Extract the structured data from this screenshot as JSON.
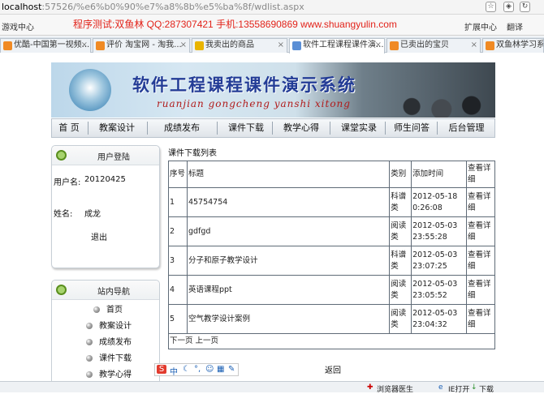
{
  "browser": {
    "url_host": "localhost",
    "url_path": ":57526/%e6%b0%90%e7%a8%8b%e5%ba%8f/wdlist.aspx",
    "promo_text": "程序测试:双鱼林 QQ:287307421 手机:13558690869 www.shuangyulin.com",
    "game_center": "游戏中心",
    "ext_center": "扩展中心",
    "translate": "翻译",
    "tabs": [
      {
        "label": "优酷-中国第一视频..."
      },
      {
        "label": "评价 淘宝网 - 淘我..."
      },
      {
        "label": "我卖出的商品"
      },
      {
        "label": "软件工程课程课件演..."
      },
      {
        "label": "已卖出的宝贝"
      },
      {
        "label": "双鱼林学习系统"
      }
    ],
    "status": {
      "doctor": "浏览器医生",
      "ie": "IE打开",
      "download": "下载"
    }
  },
  "site": {
    "title": "软件工程课程课件演示系统",
    "subtitle": "ruanjian gongcheng yanshi xitong",
    "nav": [
      "首 页",
      "教案设计",
      "成绩发布",
      "课件下载",
      "教学心得",
      "课堂实录",
      "师生问答",
      "后台管理"
    ]
  },
  "login_box": {
    "header": "用户登陆",
    "username_label": "用户名:",
    "username": "20120425",
    "name_label": "姓名:",
    "name": "成龙",
    "logout": "退出"
  },
  "site_nav": {
    "header": "站内导航",
    "items": [
      "首页",
      "教案设计",
      "成绩发布",
      "课件下载",
      "教学心得"
    ]
  },
  "main": {
    "list_title": "课件下载列表",
    "columns": [
      "序号",
      "标题",
      "类别",
      "添加时间",
      "查看详细"
    ],
    "rows": [
      {
        "no": "1",
        "title": "45754754",
        "cat": "科谱类",
        "time": "2012-05-18 0:26:08",
        "view": "查看详细"
      },
      {
        "no": "2",
        "title": "gdfgd",
        "cat": "阅读类",
        "time": "2012-05-03 23:55:28",
        "view": "查看详细"
      },
      {
        "no": "3",
        "title": "分子和原子教学设计",
        "cat": "科谱类",
        "time": "2012-05-03 23:07:25",
        "view": "查看详细"
      },
      {
        "no": "4",
        "title": "英语课程ppt",
        "cat": "阅读类",
        "time": "2012-05-03 23:05:52",
        "view": "查看详细"
      },
      {
        "no": "5",
        "title": "空气教学设计案例",
        "cat": "阅读类",
        "time": "2012-05-03 23:04:32",
        "view": "查看详细"
      }
    ],
    "pager": "下一页 上一页",
    "back": "返回"
  },
  "ime": {
    "s": "S",
    "mode": "中"
  }
}
